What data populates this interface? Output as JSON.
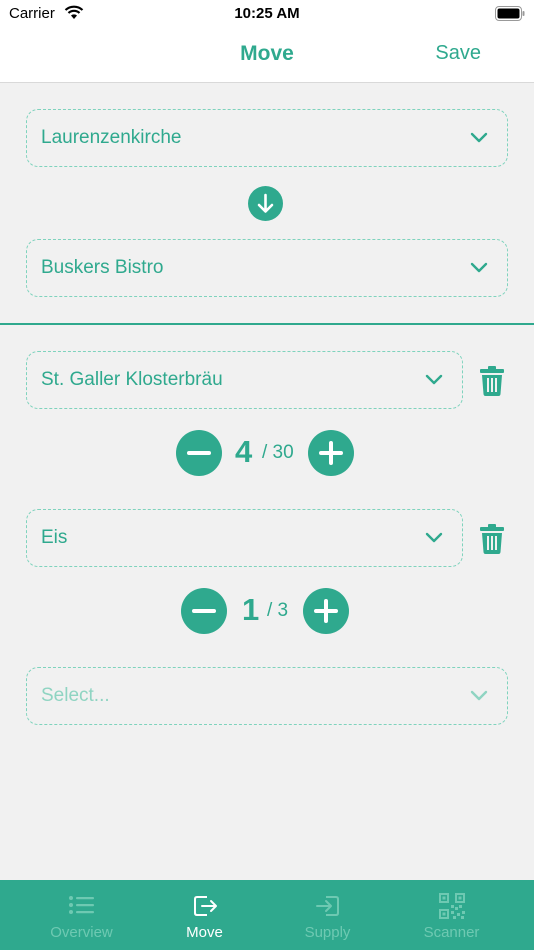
{
  "status_bar": {
    "carrier": "Carrier",
    "time": "10:25 AM"
  },
  "nav": {
    "title": "Move",
    "save_label": "Save"
  },
  "route": {
    "from": "Laurenzenkirche",
    "to": "Buskers Bistro"
  },
  "items": [
    {
      "product": "St. Galler Klosterbräu",
      "quantity": "4",
      "total": "/ 30"
    },
    {
      "product": "Eis",
      "quantity": "1",
      "total": "/ 3"
    }
  ],
  "new_item": {
    "placeholder": "Select..."
  },
  "tabs": [
    {
      "label": "Overview",
      "icon": "list-icon",
      "active": false
    },
    {
      "label": "Move",
      "icon": "move-out-icon",
      "active": true
    },
    {
      "label": "Supply",
      "icon": "supply-in-icon",
      "active": false
    },
    {
      "label": "Scanner",
      "icon": "qr-code-icon",
      "active": false
    }
  ],
  "colors": {
    "accent": "#2fa98e",
    "tab_inactive": "#6ec9b2",
    "background": "#f1f1f1"
  }
}
